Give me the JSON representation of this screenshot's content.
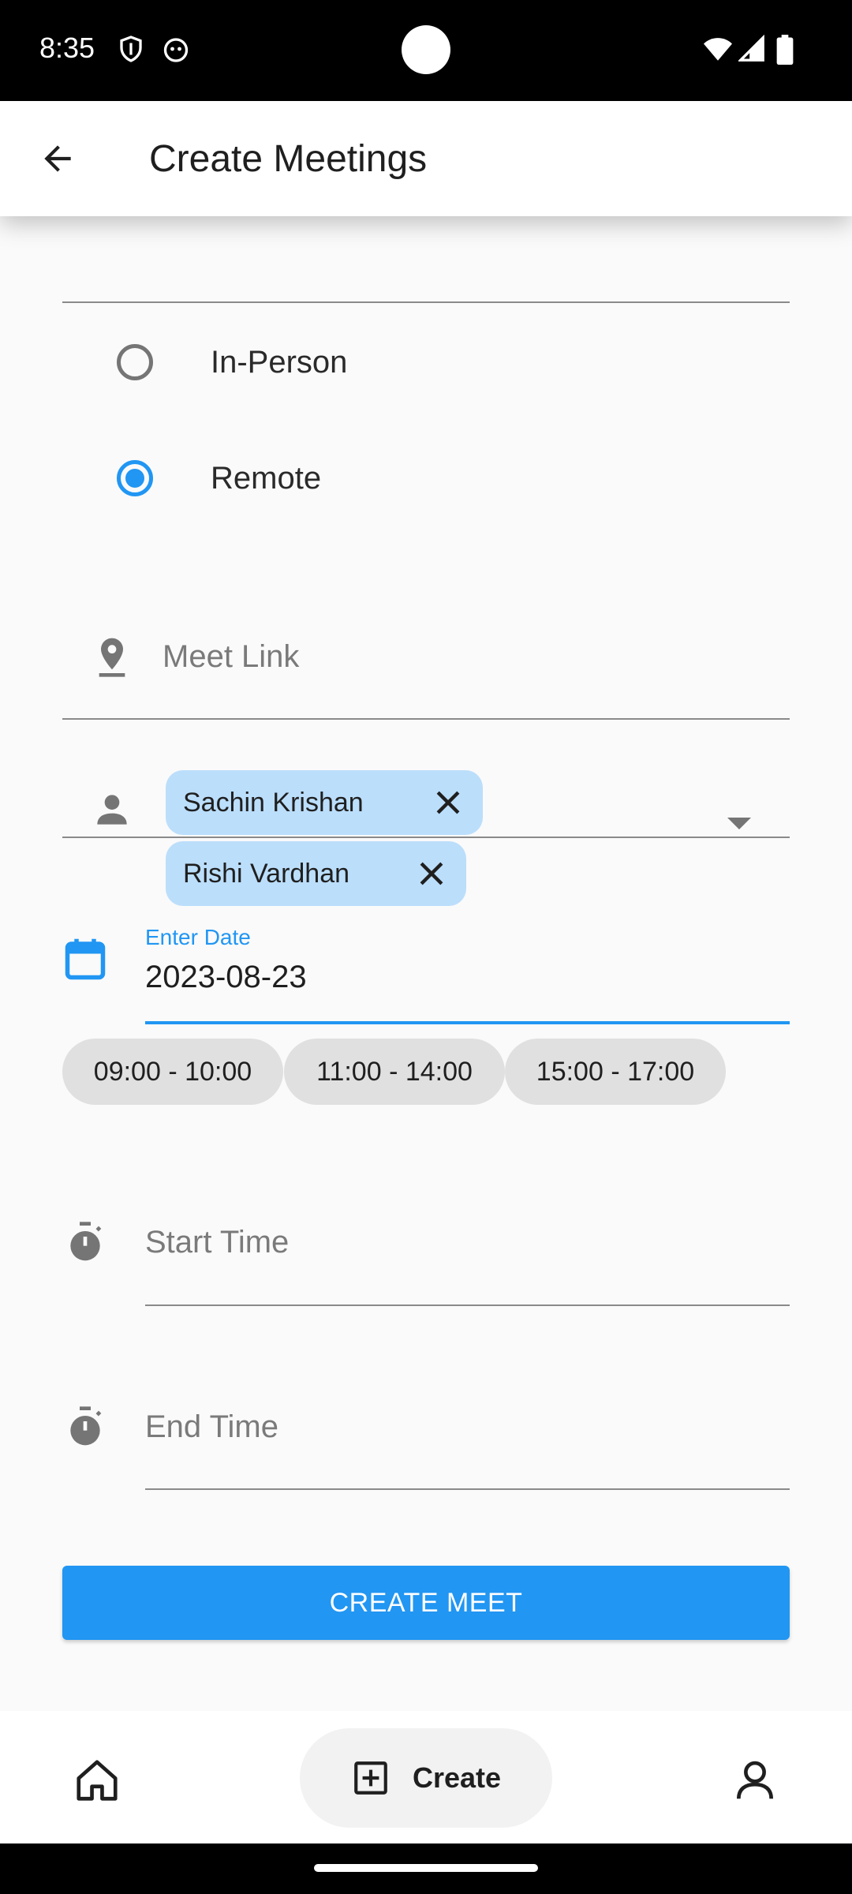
{
  "status_bar": {
    "time": "8:35"
  },
  "app_bar": {
    "title": "Create Meetings"
  },
  "meeting_type": {
    "options": [
      {
        "label": "In-Person",
        "selected": false
      },
      {
        "label": "Remote",
        "selected": true
      }
    ]
  },
  "location": {
    "placeholder": "Meet Link"
  },
  "participants": {
    "chips": [
      "Sachin Krishan",
      "Rishi Vardhan"
    ]
  },
  "date": {
    "label": "Enter Date",
    "value": "2023-08-23"
  },
  "time_slots": [
    "09:00 - 10:00",
    "11:00 - 14:00",
    "15:00 - 17:00"
  ],
  "start_time": {
    "placeholder": "Start Time"
  },
  "end_time": {
    "placeholder": "End Time"
  },
  "submit": {
    "label": "CREATE MEET"
  },
  "bottom_nav": {
    "create_label": "Create"
  },
  "colors": {
    "accent": "#2196f3",
    "chip_bg": "#bbdefb",
    "slot_bg": "#e0e0e0"
  }
}
